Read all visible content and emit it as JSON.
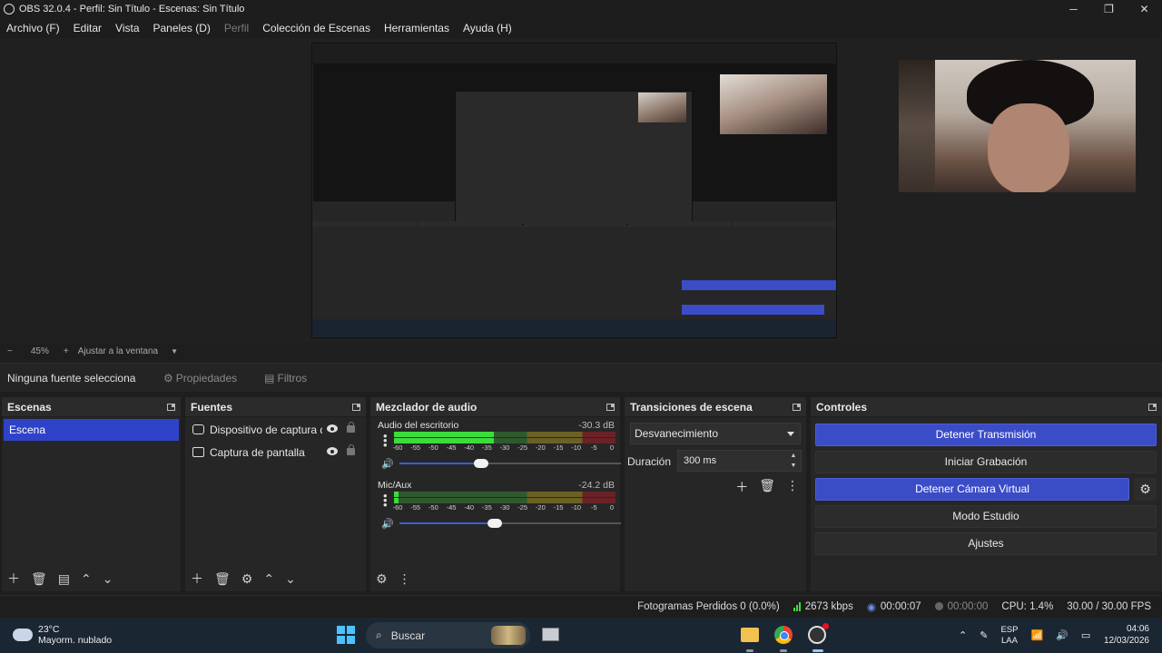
{
  "window": {
    "title": "OBS 32.0.4 - Perfil: Sin Título - Escenas: Sin Título",
    "minimize": "─",
    "maximize": "❐",
    "close": "✕"
  },
  "menu": [
    "Archivo (F)",
    "Editar",
    "Vista",
    "Paneles (D)",
    "Perfil",
    "Colección de Escenas",
    "Herramientas",
    "Ayuda (H)"
  ],
  "preview": {
    "zoom_minus": "−",
    "zoom_level": "45%",
    "zoom_plus": "+",
    "fit_label": "Ajustar a la ventana"
  },
  "source_bar": {
    "no_source": "Ninguna fuente selecciona",
    "properties": "Propiedades",
    "filters": "Filtros"
  },
  "scenes": {
    "title": "Escenas",
    "items": [
      "Escena"
    ]
  },
  "sources": {
    "title": "Fuentes",
    "items": [
      "Dispositivo de captura d",
      "Captura de pantalla"
    ]
  },
  "mixer": {
    "title": "Mezclador de audio",
    "channels": [
      {
        "name": "Audio del escritorio",
        "db": "-30.3 dB",
        "level": 0.45,
        "volume": 0.37
      },
      {
        "name": "Mic/Aux",
        "db": "-24.2 dB",
        "level": 0.02,
        "volume": 0.43
      }
    ],
    "scale": [
      "-60",
      "-55",
      "-50",
      "-45",
      "-40",
      "-35",
      "-30",
      "-25",
      "-20",
      "-15",
      "-10",
      "-5",
      "0"
    ]
  },
  "transitions": {
    "title": "Transiciones de escena",
    "selected": "Desvanecimiento",
    "duration_label": "Duración",
    "duration_value": "300 ms"
  },
  "controls": {
    "title": "Controles",
    "buttons": [
      "Detener Transmisión",
      "Iniciar Grabación",
      "Detener Cámara Virtual",
      "Modo Estudio",
      "Ajustes"
    ]
  },
  "status": {
    "dropped": "Fotogramas Perdidos 0 (0.0%)",
    "bitrate": "2673 kbps",
    "stream_time": "00:00:07",
    "rec_time": "00:00:00",
    "cpu": "CPU: 1.4%",
    "fps": "30.00 / 30.00 FPS"
  },
  "taskbar": {
    "temp": "23°C",
    "weather": "Mayorm. nublado",
    "search": "Buscar",
    "lang1": "ESP",
    "lang2": "LAA",
    "time": "04:06",
    "date": "12/03/2026"
  },
  "colors": {
    "accent": "#3b4cc7",
    "scene_selected": "#2f43c8",
    "meter_green": "#3ddc3d"
  }
}
